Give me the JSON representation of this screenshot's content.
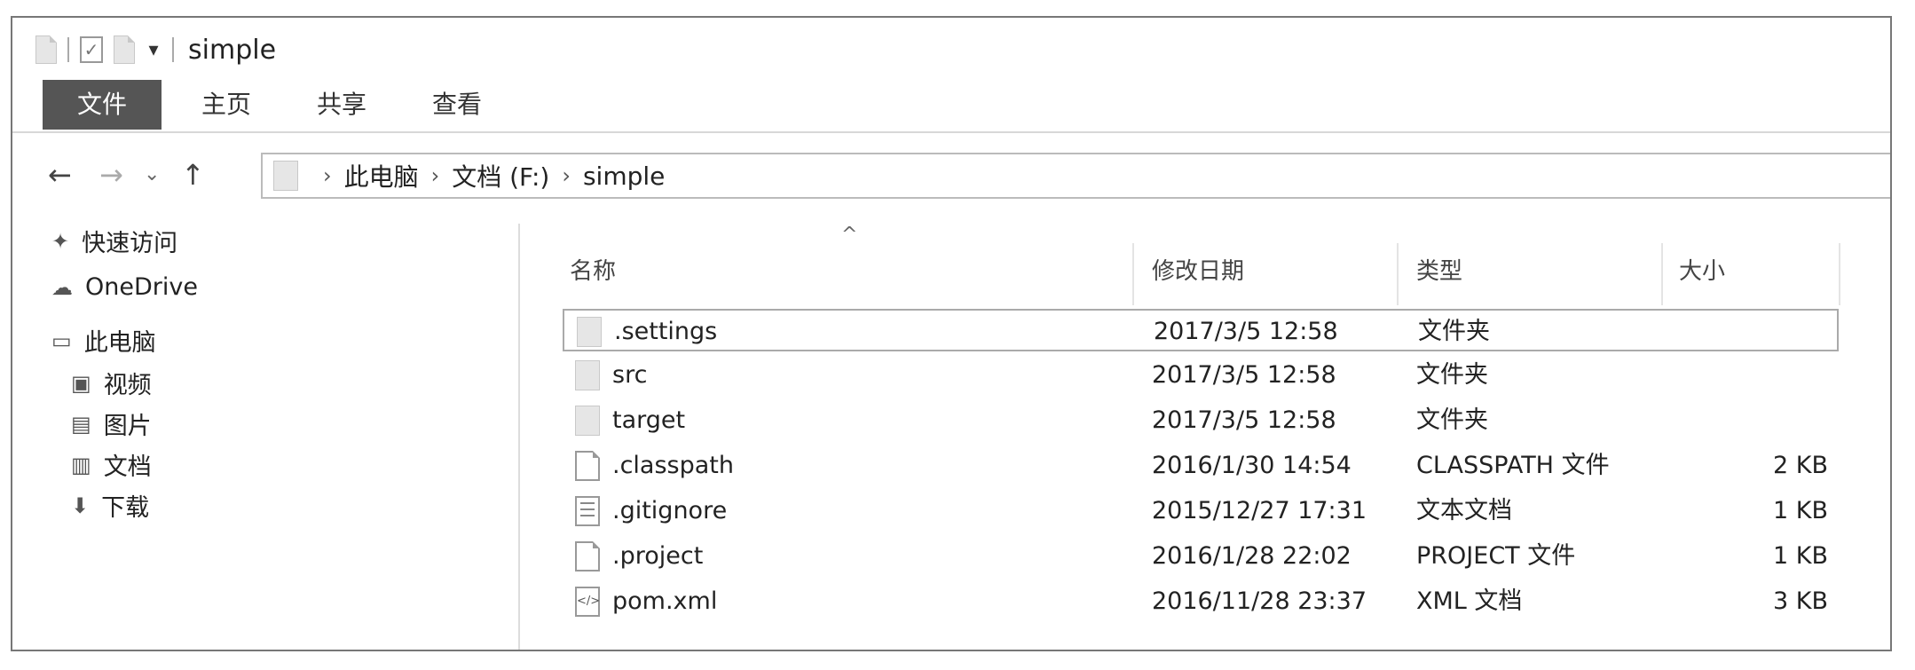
{
  "window": {
    "title": "simple"
  },
  "ribbon": {
    "tabs": [
      "文件",
      "主页",
      "共享",
      "查看"
    ]
  },
  "address": {
    "crumbs": [
      "此电脑",
      "文档 (F:)",
      "simple"
    ]
  },
  "nav_pane": {
    "items": [
      {
        "label": "快速访问",
        "icon": "pin-icon"
      },
      {
        "label": "OneDrive",
        "icon": "cloud-icon"
      },
      {
        "label": "此电脑",
        "icon": "computer-icon"
      },
      {
        "label": "视频",
        "icon": "video-icon"
      },
      {
        "label": "图片",
        "icon": "pictures-icon"
      },
      {
        "label": "文档",
        "icon": "documents-icon"
      },
      {
        "label": "下载",
        "icon": "download-icon"
      }
    ]
  },
  "columns": {
    "name": "名称",
    "modified": "修改日期",
    "type": "类型",
    "size": "大小"
  },
  "files": [
    {
      "name": ".settings",
      "modified": "2017/3/5 12:58",
      "type": "文件夹",
      "size": "",
      "icon": "folder"
    },
    {
      "name": "src",
      "modified": "2017/3/5 12:58",
      "type": "文件夹",
      "size": "",
      "icon": "folder"
    },
    {
      "name": "target",
      "modified": "2017/3/5 12:58",
      "type": "文件夹",
      "size": "",
      "icon": "folder"
    },
    {
      "name": ".classpath",
      "modified": "2016/1/30 14:54",
      "type": "CLASSPATH 文件",
      "size": "2 KB",
      "icon": "file"
    },
    {
      "name": ".gitignore",
      "modified": "2015/12/27 17:31",
      "type": "文本文档",
      "size": "1 KB",
      "icon": "text"
    },
    {
      "name": ".project",
      "modified": "2016/1/28 22:02",
      "type": "PROJECT 文件",
      "size": "1 KB",
      "icon": "file"
    },
    {
      "name": "pom.xml",
      "modified": "2016/11/28 23:37",
      "type": "XML 文档",
      "size": "3 KB",
      "icon": "xml"
    }
  ]
}
